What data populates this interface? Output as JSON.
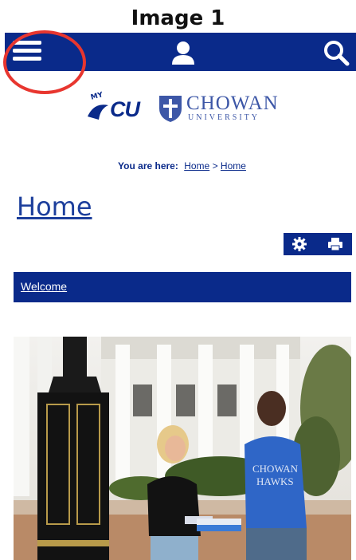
{
  "caption": "Image 1",
  "navbar": {
    "menu_icon": "hamburger-menu-icon",
    "user_icon": "user-icon",
    "search_icon": "search-icon",
    "background": "#0a2a8a"
  },
  "logos": {
    "mycu_small": "MY",
    "mycu_big": "CU",
    "chowan_name": "CHOWAN",
    "chowan_sub": "UNIVERSITY"
  },
  "breadcrumb": {
    "label": "You are here:",
    "items": [
      "Home",
      "Home"
    ],
    "separator": ">"
  },
  "page": {
    "title": "Home"
  },
  "tools": {
    "settings_icon": "gear-icon",
    "print_icon": "printer-icon"
  },
  "welcome": {
    "label": "Welcome"
  },
  "photo": {
    "shirt_text": "CHOWAN HAWKS"
  },
  "colors": {
    "brand": "#0a2a8a",
    "highlight": "#e8362f"
  }
}
